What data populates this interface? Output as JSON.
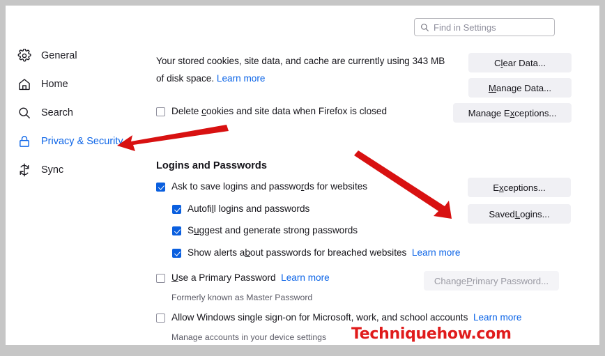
{
  "search": {
    "placeholder": "Find in Settings",
    "value": "",
    "icon": "search-icon"
  },
  "sidebar": {
    "items": [
      {
        "label": "General",
        "icon": "gear-icon",
        "selected": false
      },
      {
        "label": "Home",
        "icon": "home-icon",
        "selected": false
      },
      {
        "label": "Search",
        "icon": "search-icon",
        "selected": false
      },
      {
        "label": "Privacy & Security",
        "icon": "lock-icon",
        "selected": true
      },
      {
        "label": "Sync",
        "icon": "sync-icon",
        "selected": false
      }
    ]
  },
  "cookies_section": {
    "description_part1": "Your stored cookies, site data, and cache are currently using 343 MB of disk space.",
    "learn_more": "Learn more",
    "storage_used": "343 MB",
    "delete_on_close": {
      "label_before": "Delete ",
      "accel": "c",
      "label_after": "ookies and site data when Firefox is closed",
      "checked": false
    },
    "buttons": [
      {
        "before": "C",
        "accel": "l",
        "after": "ear Data...",
        "disabled": false
      },
      {
        "before": "",
        "accel": "M",
        "after": "anage Data...",
        "disabled": false
      },
      {
        "before": "Manage E",
        "accel": "x",
        "after": "ceptions...",
        "disabled": false
      }
    ]
  },
  "logins_section": {
    "title": "Logins and Passwords",
    "checkboxes": [
      {
        "before": "Ask to save logins and passwo",
        "accel": "r",
        "after": "ds for websites",
        "checked": true,
        "indent": false,
        "learn_more": null
      },
      {
        "before": "Autofi",
        "accel": "l",
        "after": "l logins and passwords",
        "checked": true,
        "indent": true,
        "learn_more": null
      },
      {
        "before": "S",
        "accel": "u",
        "after": "ggest and generate strong passwords",
        "checked": true,
        "indent": true,
        "learn_more": null
      },
      {
        "before": "Show alerts a",
        "accel": "b",
        "after": "out passwords for breached websites",
        "checked": true,
        "indent": true,
        "learn_more": "Learn more"
      }
    ],
    "primary_password": {
      "before": "",
      "accel": "U",
      "after": "se a Primary Password",
      "checked": false,
      "learn_more": "Learn more",
      "subtext": "Formerly known as Master Password"
    },
    "windows_sso": {
      "label": "Allow Windows single sign-on for Microsoft, work, and school accounts",
      "checked": false,
      "learn_more": "Learn more",
      "subtext": "Manage accounts in your device settings"
    },
    "buttons": [
      {
        "before": "E",
        "accel": "x",
        "after": "ceptions...",
        "disabled": false
      },
      {
        "before": "Saved ",
        "accel": "L",
        "after": "ogins...",
        "disabled": false
      },
      {
        "before": "Change ",
        "accel": "P",
        "after": "rimary Password...",
        "disabled": true
      }
    ]
  },
  "annotations": {
    "arrow1_target": "Privacy & Security",
    "arrow2_target": "Saved Logins...",
    "arrow_color": "#d81111",
    "watermark": "Techniquehow.com"
  }
}
